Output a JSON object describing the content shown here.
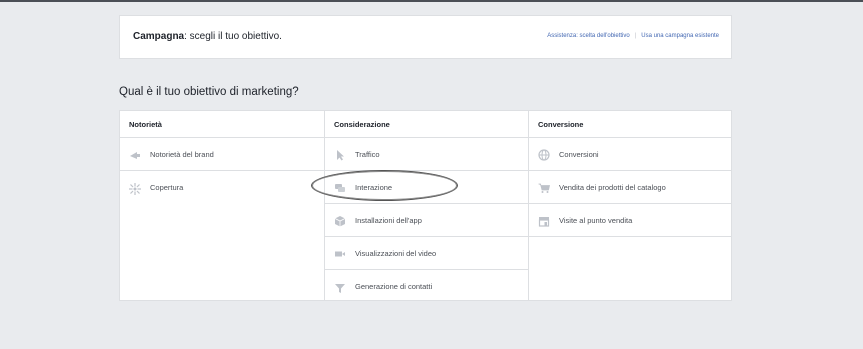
{
  "header": {
    "title_bold": "Campagna",
    "title_rest": ": scegli il tuo obiettivo.",
    "help_link": "Assistenza: scelta dell'obiettivo",
    "existing_link": "Usa una campagna esistente"
  },
  "question": "Qual è il tuo obiettivo di marketing?",
  "columns": [
    {
      "title": "Notorietà",
      "items": [
        {
          "label": "Notorietà del brand",
          "icon": "megaphone-icon"
        },
        {
          "label": "Copertura",
          "icon": "reach-icon"
        }
      ]
    },
    {
      "title": "Considerazione",
      "items": [
        {
          "label": "Traffico",
          "icon": "cursor-icon"
        },
        {
          "label": "Interazione",
          "icon": "chat-bubbles-icon"
        },
        {
          "label": "Installazioni dell'app",
          "icon": "app-box-icon"
        },
        {
          "label": "Visualizzazioni del video",
          "icon": "video-camera-icon"
        },
        {
          "label": "Generazione di contatti",
          "icon": "funnel-icon"
        }
      ]
    },
    {
      "title": "Conversione",
      "items": [
        {
          "label": "Conversioni",
          "icon": "globe-icon"
        },
        {
          "label": "Vendita dei prodotti del catalogo",
          "icon": "shopping-cart-icon"
        },
        {
          "label": "Visite al punto vendita",
          "icon": "store-icon"
        }
      ]
    }
  ],
  "colors": {
    "background": "#e9ebee",
    "icon_gray": "#bec2c9",
    "link": "#4267b2"
  }
}
